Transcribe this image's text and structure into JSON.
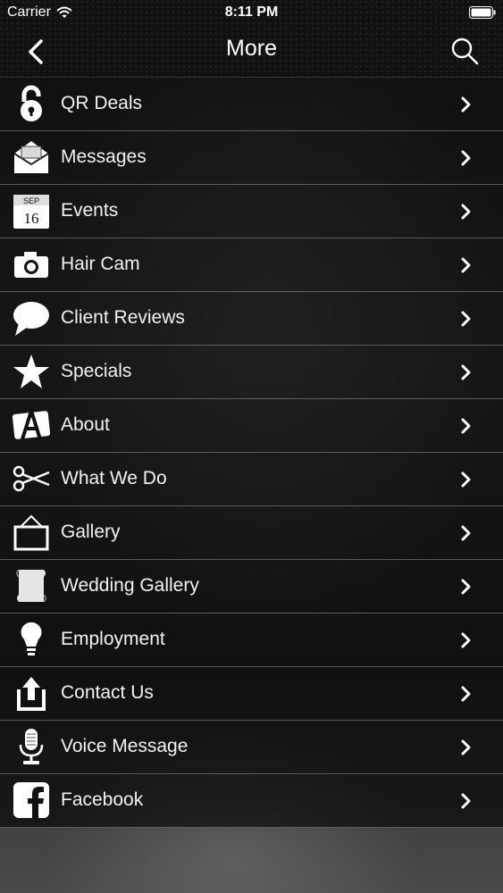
{
  "status_bar": {
    "carrier": "Carrier",
    "time": "8:11 PM"
  },
  "nav": {
    "title": "More"
  },
  "menu": [
    {
      "label": "QR Deals",
      "icon": "lock-icon"
    },
    {
      "label": "Messages",
      "icon": "envelope-icon"
    },
    {
      "label": "Events",
      "icon": "calendar-icon",
      "cal_month": "SEP",
      "cal_day": "16"
    },
    {
      "label": "Hair Cam",
      "icon": "camera-icon"
    },
    {
      "label": "Client Reviews",
      "icon": "speech-bubble-icon"
    },
    {
      "label": "Specials",
      "icon": "star-icon"
    },
    {
      "label": "About",
      "icon": "about-icon"
    },
    {
      "label": "What We Do",
      "icon": "scissors-icon"
    },
    {
      "label": "Gallery",
      "icon": "picture-frame-icon"
    },
    {
      "label": "Wedding Gallery",
      "icon": "scroll-icon"
    },
    {
      "label": "Employment",
      "icon": "lightbulb-icon"
    },
    {
      "label": "Contact Us",
      "icon": "upload-icon"
    },
    {
      "label": "Voice Message",
      "icon": "microphone-icon"
    },
    {
      "label": "Facebook",
      "icon": "facebook-icon"
    }
  ]
}
